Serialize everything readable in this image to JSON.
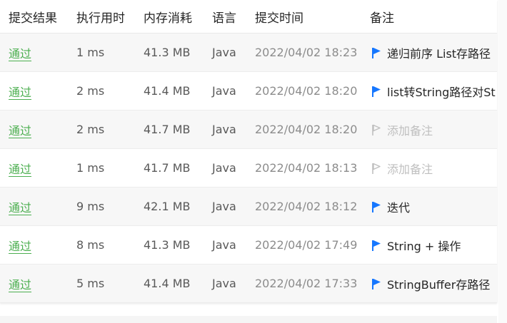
{
  "header": {
    "result": "提交结果",
    "runtime": "执行用时",
    "memory": "内存消耗",
    "language": "语言",
    "submit_time": "提交时间",
    "note": "备注"
  },
  "rows": [
    {
      "result": "通过",
      "runtime": "1 ms",
      "memory": "41.3 MB",
      "language": "Java",
      "time": "2022/04/02 18:23",
      "note": "递归前序 List存路径",
      "note_set": true
    },
    {
      "result": "通过",
      "runtime": "2 ms",
      "memory": "41.4 MB",
      "language": "Java",
      "time": "2022/04/02 18:20",
      "note": "list转String路径对St",
      "note_set": true
    },
    {
      "result": "通过",
      "runtime": "2 ms",
      "memory": "41.7 MB",
      "language": "Java",
      "time": "2022/04/02 18:20",
      "note": "添加备注",
      "note_set": false
    },
    {
      "result": "通过",
      "runtime": "1 ms",
      "memory": "41.7 MB",
      "language": "Java",
      "time": "2022/04/02 18:13",
      "note": "添加备注",
      "note_set": false
    },
    {
      "result": "通过",
      "runtime": "9 ms",
      "memory": "42.1 MB",
      "language": "Java",
      "time": "2022/04/02 18:12",
      "note": "迭代",
      "note_set": true
    },
    {
      "result": "通过",
      "runtime": "8 ms",
      "memory": "41.3 MB",
      "language": "Java",
      "time": "2022/04/02 17:49",
      "note": "String + 操作",
      "note_set": true
    },
    {
      "result": "通过",
      "runtime": "5 ms",
      "memory": "41.4 MB",
      "language": "Java",
      "time": "2022/04/02 17:33",
      "note": "StringBuffer存路径",
      "note_set": true
    }
  ],
  "colors": {
    "pass": "#4caf50",
    "flag_active": "#1677ff",
    "flag_inactive": "#bfbfbf"
  },
  "icons": {
    "flag_set": "flag-filled-icon",
    "flag_empty": "flag-outline-icon"
  }
}
